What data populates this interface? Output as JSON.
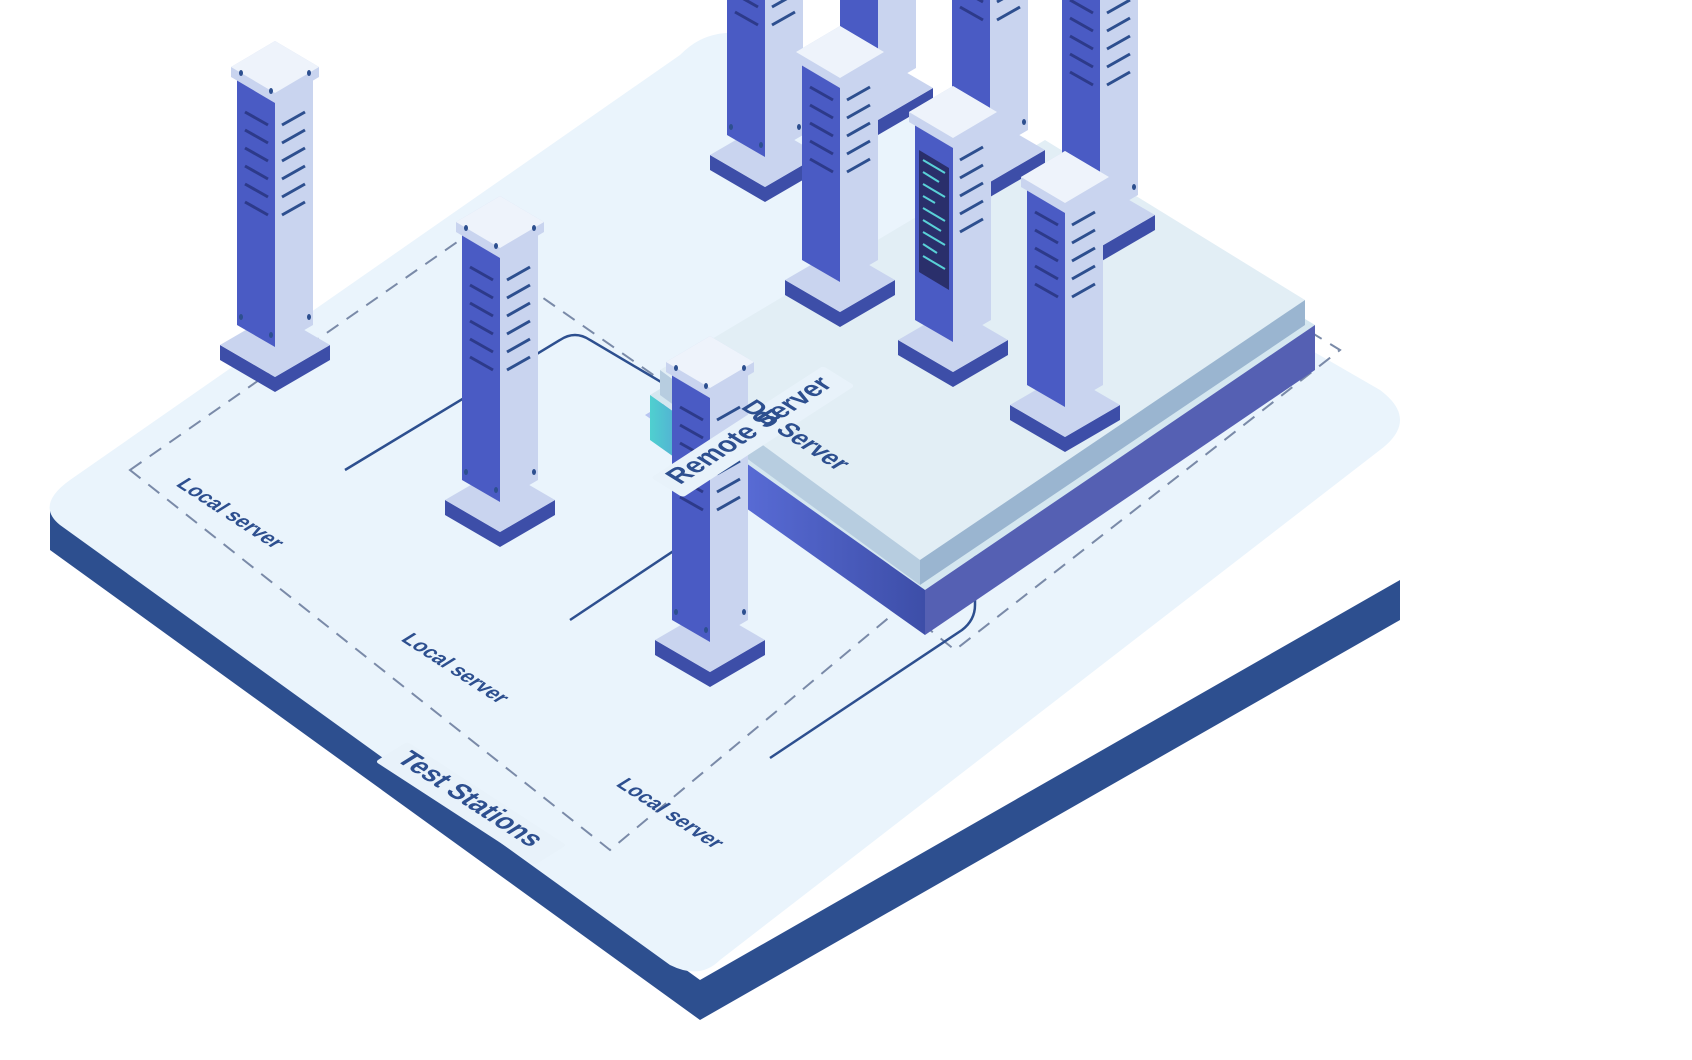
{
  "labels": {
    "testStations": "Test Stations",
    "remoteServer": "Remote Server",
    "dbServer": "DB Server",
    "local1": "Local server",
    "local2": "Local server",
    "local3": "Local server"
  },
  "colors": {
    "platformLight": "#eaf4fc",
    "platformSide": "#2d4f8f",
    "serverFrontDark": "#3d4ea8",
    "serverFrontLight": "#5a6dd8",
    "serverSide": "#c9d4ef",
    "serverTop": "#e0e8f8",
    "serverBase": "#3d4ea8",
    "dashed": "#7a8aa8",
    "arrow": "#2d4f8f",
    "dbPlatformTop": "#d5e7f0",
    "dbPlatformSide": "#5560b3",
    "dbPlatformEdge": "#6b7de0",
    "labelBg": "#e8f2fa"
  }
}
